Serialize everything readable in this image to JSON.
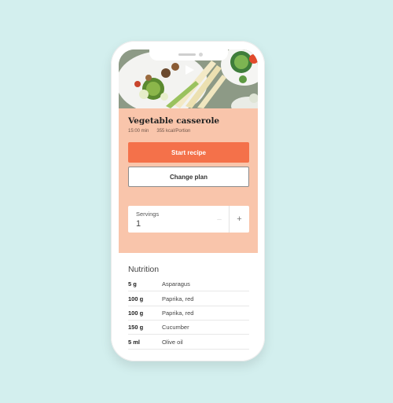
{
  "recipe": {
    "title": "Vegetable casserole",
    "time": "15:00 min",
    "calories": "355 kcal/Portion",
    "start_label": "Start recipe",
    "change_label": "Change plan"
  },
  "servings": {
    "label": "Servings",
    "value": "1",
    "minus": "–",
    "plus": "+"
  },
  "nutrition": {
    "title": "Nutrition",
    "rows": [
      {
        "qty": "5 g",
        "name": "Asparagus"
      },
      {
        "qty": "100 g",
        "name": "Paprika, red"
      },
      {
        "qty": "100 g",
        "name": "Paprika, red"
      },
      {
        "qty": "150 g",
        "name": "Cucumber"
      },
      {
        "qty": "5 ml",
        "name": "Olive oil"
      }
    ]
  },
  "colors": {
    "background": "#d3efee",
    "accent": "#f4714a",
    "recipe_panel": "#f9c5ab"
  },
  "icons": {
    "hero_play": "play-icon"
  }
}
